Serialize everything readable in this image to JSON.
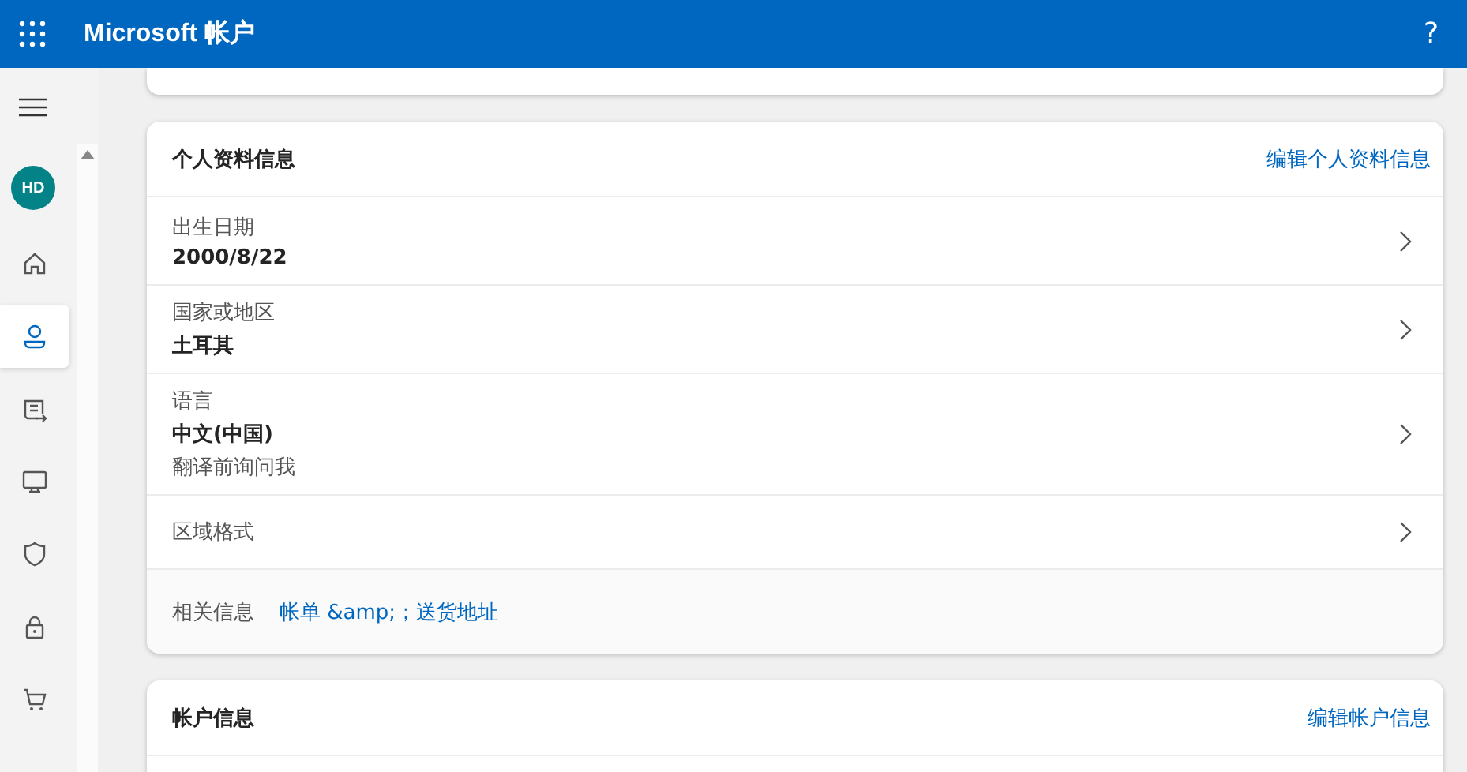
{
  "header": {
    "title": "Microsoft 帐户",
    "help": "?"
  },
  "nav": {
    "avatar": "HD",
    "items": [
      {
        "kind": "home",
        "selected": false
      },
      {
        "kind": "person",
        "selected": true
      },
      {
        "kind": "feed",
        "selected": false
      },
      {
        "kind": "monitor",
        "selected": false
      },
      {
        "kind": "shield",
        "selected": false
      },
      {
        "kind": "lock",
        "selected": false
      },
      {
        "kind": "cart",
        "selected": false
      }
    ]
  },
  "profile_card": {
    "title": "个人资料信息",
    "edit_link": "编辑个人资料信息",
    "rows": [
      {
        "label": "出生日期",
        "value": "2000/8/22"
      },
      {
        "label": "国家或地区",
        "value": "土耳其"
      },
      {
        "label": "语言",
        "value": "中文(中国)",
        "note": "翻译前询问我"
      },
      {
        "label": "区域格式"
      }
    ],
    "related": {
      "label": "相关信息",
      "link": "帐单 &amp;；送货地址"
    }
  },
  "account_card": {
    "title": "帐户信息",
    "edit_link": "编辑帐户信息"
  }
}
